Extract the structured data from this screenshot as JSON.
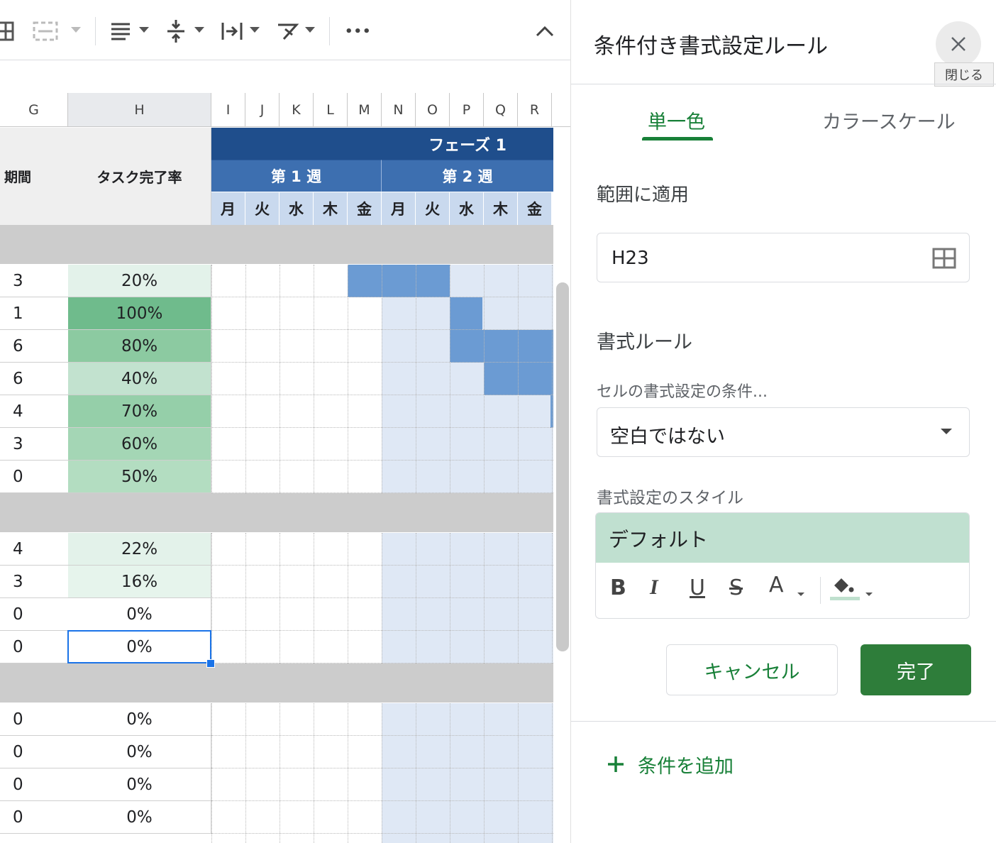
{
  "toolbar": {
    "icons": [
      "table-icon",
      "merge-cells-icon",
      "horizontal-align-icon",
      "vertical-align-icon",
      "text-wrap-icon",
      "text-rotate-icon",
      "more-icon",
      "collapse-icon"
    ],
    "more_label": "•••"
  },
  "sheet": {
    "columns": [
      "G",
      "H",
      "I",
      "J",
      "K",
      "L",
      "M",
      "N",
      "O",
      "P",
      "Q",
      "R"
    ],
    "selected_column": "H",
    "header_g": "期間",
    "header_h": "タスク完了率",
    "phase_label": "フェーズ 1",
    "week1_label": "第 1 週",
    "week2_label": "第 2 週",
    "days": [
      "月",
      "火",
      "水",
      "木",
      "金",
      "月",
      "火",
      "水",
      "木",
      "金"
    ],
    "rows": [
      {
        "g": "3",
        "h": "20%"
      },
      {
        "g": "1",
        "h": "100%"
      },
      {
        "g": "6",
        "h": "80%"
      },
      {
        "g": "6",
        "h": "40%"
      },
      {
        "g": "4",
        "h": "70%"
      },
      {
        "g": "3",
        "h": "60%"
      },
      {
        "g": "0",
        "h": "50%"
      },
      {
        "g": "4",
        "h": "22%"
      },
      {
        "g": "3",
        "h": "16%"
      },
      {
        "g": "0",
        "h": "0%"
      },
      {
        "g": "0",
        "h": "0%"
      },
      {
        "g": "0",
        "h": "0%"
      },
      {
        "g": "0",
        "h": "0%"
      },
      {
        "g": "0",
        "h": "0%"
      },
      {
        "g": "0",
        "h": "0%"
      }
    ],
    "selected_cell": "H23",
    "colors": {
      "header_dark": "#1f4e8c",
      "header_mid": "#3d6fb0",
      "header_light": "#c9d9ee",
      "bar": "#6b9bd3",
      "band": "#dfe8f5",
      "separator": "#cccccc",
      "selection": "#1a73e8"
    }
  },
  "panel": {
    "title": "条件付き書式設定ルール",
    "close_tooltip": "閉じる",
    "tab_single": "単一色",
    "tab_scale": "カラースケール",
    "range_label": "範囲に適用",
    "range_value": "H23",
    "rules_label": "書式ルール",
    "condition_label": "セルの書式設定の条件...",
    "condition_value": "空白ではない",
    "style_label": "書式設定のスタイル",
    "style_preview": "デフォルト",
    "style_buttons": {
      "bold": "B",
      "italic": "I",
      "underline": "U",
      "strike": "S",
      "text_color": "A"
    },
    "cancel_label": "キャンセル",
    "done_label": "完了",
    "add_rule_label": "条件を追加",
    "accent_color": "#188038"
  }
}
